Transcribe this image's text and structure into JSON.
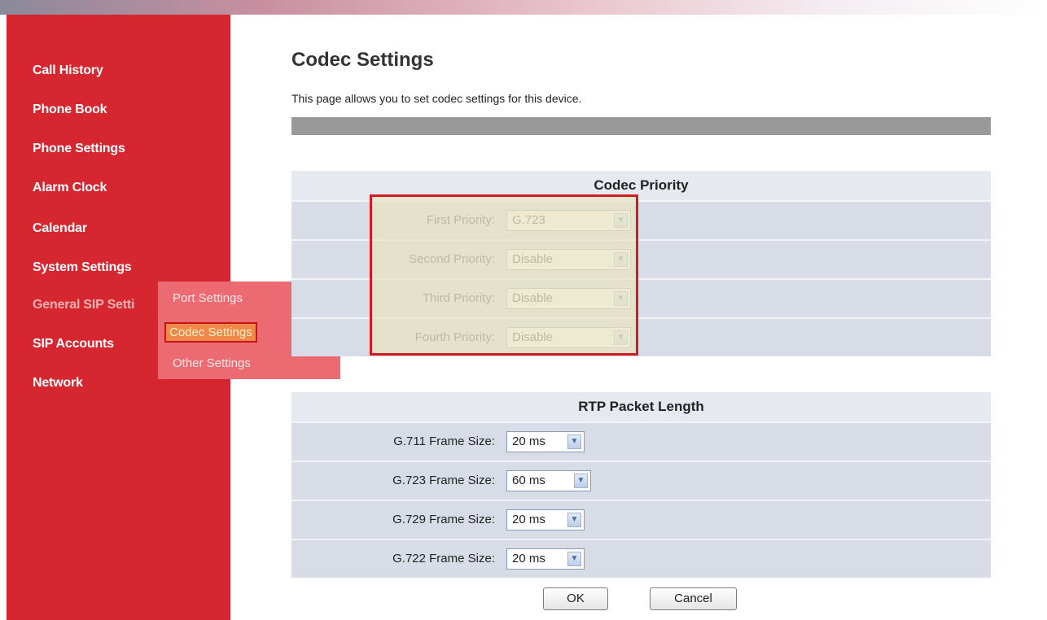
{
  "sidebar": {
    "items": [
      {
        "label": "Call History"
      },
      {
        "label": "Phone Book"
      },
      {
        "label": "Phone Settings"
      },
      {
        "label": "Alarm Clock"
      },
      {
        "label": "Calendar"
      },
      {
        "label": "System Settings"
      },
      {
        "label": "General SIP Setti"
      },
      {
        "label": "SIP Accounts"
      },
      {
        "label": "Network"
      }
    ],
    "flyout": [
      {
        "label": "Port Settings"
      },
      {
        "label": "Codec Settings"
      },
      {
        "label": "Other Settings"
      }
    ]
  },
  "page": {
    "title": "Codec Settings",
    "description": "This page allows you to set codec settings for this device."
  },
  "codec_priority": {
    "heading": "Codec Priority",
    "rows": [
      {
        "label": "First Priority:",
        "value": "G.723"
      },
      {
        "label": "Second Priority:",
        "value": "Disable"
      },
      {
        "label": "Third Priority:",
        "value": "Disable"
      },
      {
        "label": "Fourth Priority:",
        "value": "Disable"
      }
    ]
  },
  "rtp": {
    "heading": "RTP Packet Length",
    "rows": [
      {
        "label": "G.711 Frame Size:",
        "value": "20 ms"
      },
      {
        "label": "G.723 Frame Size:",
        "value": "60 ms"
      },
      {
        "label": "G.729 Frame Size:",
        "value": "20 ms"
      },
      {
        "label": "G.722 Frame Size:",
        "value": "20 ms"
      }
    ]
  },
  "buttons": {
    "ok": "OK",
    "cancel": "Cancel"
  },
  "colors": {
    "sidebar": "#d6262f",
    "highlight_border": "#d11a22",
    "section_bg": "#d8dce6"
  },
  "icons": {
    "dropdown": "chevron-down-icon"
  }
}
